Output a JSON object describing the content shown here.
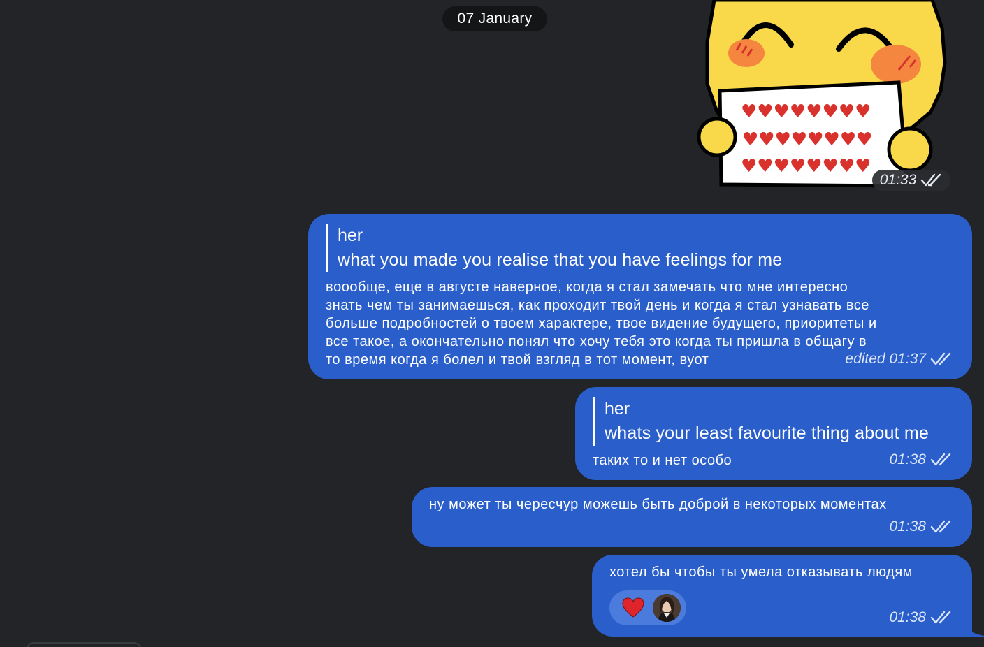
{
  "date_separator": "07 January",
  "sticker": {
    "icon": "hugging-emoji-hearts-sticker",
    "time": "01:33",
    "status": "read"
  },
  "messages": [
    {
      "quote_author": "her",
      "quote_text": "what you made you realise that you have feelings for me",
      "text": "вooобще, еще в августе наверное, когда я стал замечать что мне интересно\nзнать чем ты занимаешься, как проходит твой день и когда я стал узнавать все\nбольше подробностей о твоем характере, твое видение будущего, приоритеты и\nвсе такое, а окончательно понял что хочу тебя это когда ты пришла в общагу в\nто время когда я болел и твой взгляд в тот момент, вуот",
      "meta": "edited 01:37",
      "status": "read"
    },
    {
      "quote_author": "her",
      "quote_text": "whats your least favourite thing about me",
      "text": "таких то и нет особо",
      "meta": "01:38",
      "status": "read"
    },
    {
      "text": "ну может ты чересчур можешь быть доброй в некоторых моментах",
      "meta": "01:38",
      "status": "read"
    },
    {
      "text": "хотел бы чтобы ты умела отказывать людям",
      "meta": "01:38",
      "status": "read",
      "reaction": {
        "emoji_icon": "red-heart-icon",
        "reactor": "avatar"
      }
    }
  ],
  "colors": {
    "background": "#222427",
    "outgoing_bubble": "#2a5fcb",
    "date_pill": "#141517",
    "reaction_pill": "#4b7bdc"
  }
}
